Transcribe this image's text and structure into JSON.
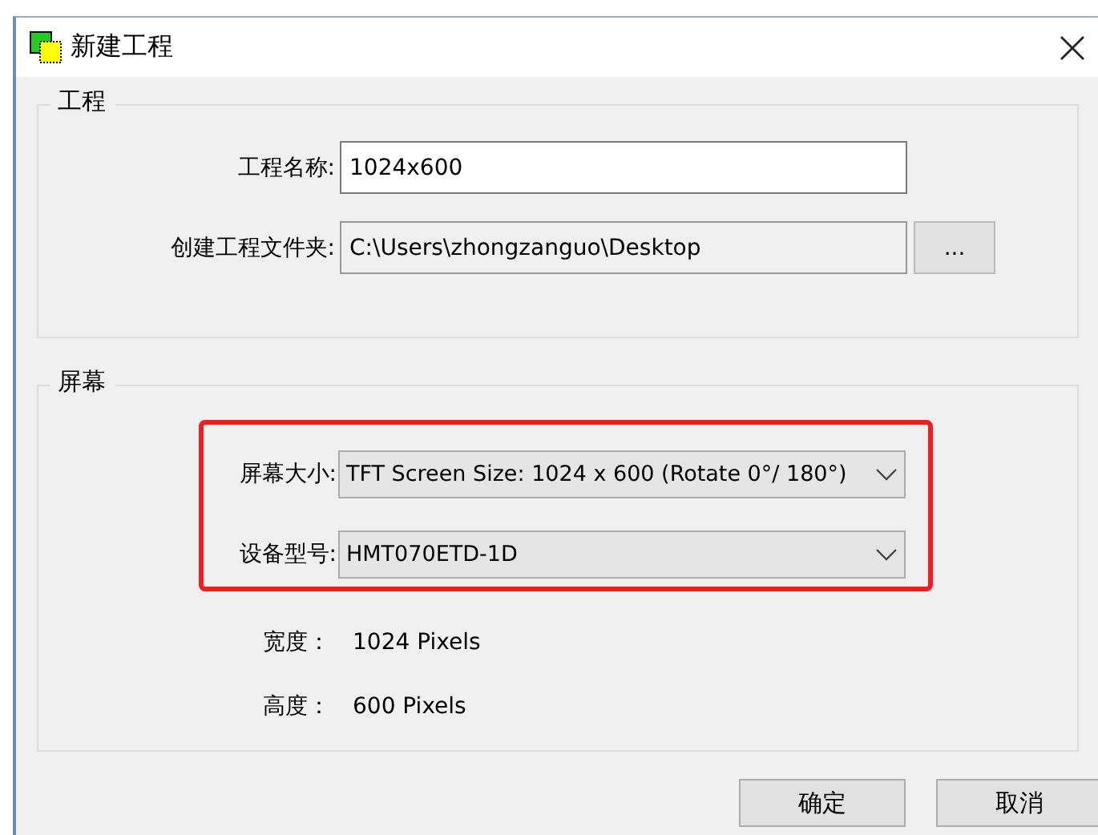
{
  "window": {
    "title": "新建工程"
  },
  "project_group": {
    "title": "工程",
    "name_label": "工程名称:",
    "name_value": "1024x600",
    "folder_label": "创建工程文件夹:",
    "folder_value": "C:\\Users\\zhongzanguo\\Desktop",
    "browse_button": "..."
  },
  "screen_group": {
    "title": "屏幕",
    "highlighted": true,
    "dropdowns": [
      {
        "label": "屏幕大小:",
        "value": "TFT Screen Size: 1024 x 600 (Rotate 0°/ 180°)"
      },
      {
        "label": "设备型号:",
        "value": "HMT070ETD-1D"
      }
    ],
    "info": [
      {
        "label": "宽度：",
        "value": "1024 Pixels"
      },
      {
        "label": "高度：",
        "value": "600 Pixels"
      }
    ]
  },
  "buttons": [
    "确定",
    "取消"
  ]
}
